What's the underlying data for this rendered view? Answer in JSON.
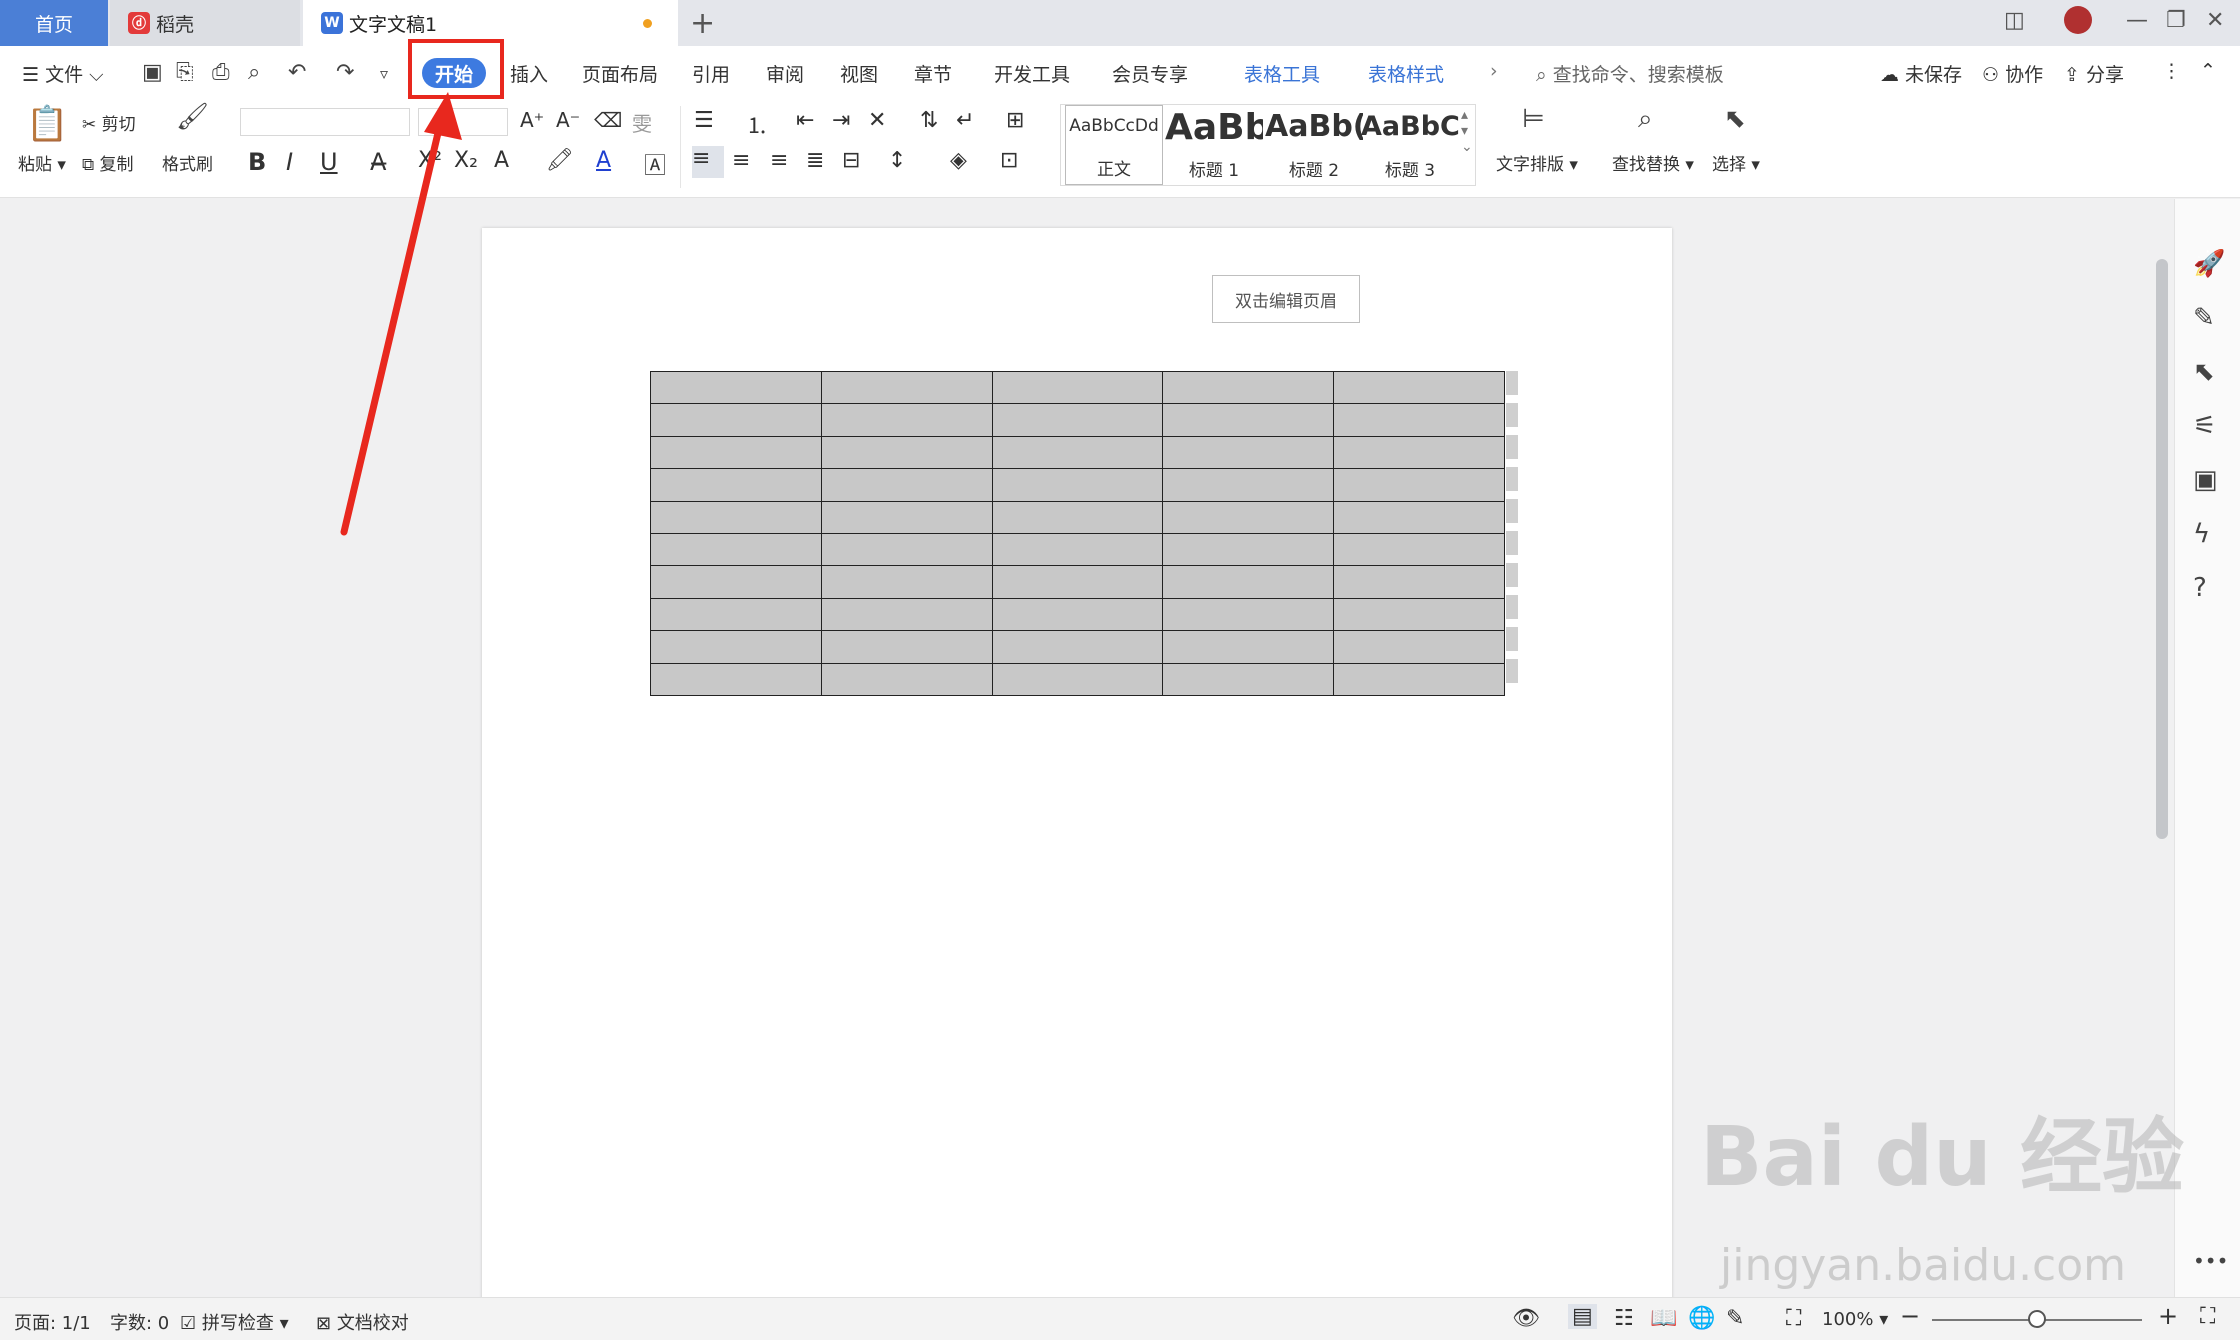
{
  "tabs": {
    "home": "首页",
    "daoke": "稻壳",
    "doc": "文字文稿1"
  },
  "menu": {
    "file": "文件",
    "start": "开始",
    "insert": "插入",
    "layout": "页面布局",
    "reference": "引用",
    "review": "审阅",
    "view": "视图",
    "chapter": "章节",
    "devtools": "开发工具",
    "member": "会员专享",
    "table_tools": "表格工具",
    "table_style": "表格样式",
    "search_placeholder": "查找命令、搜索模板",
    "unsaved": "未保存",
    "collab": "协作",
    "share": "分享"
  },
  "toolbar": {
    "paste": "粘贴",
    "cut": "剪切",
    "copy": "复制",
    "format_painter": "格式刷",
    "text_layout": "文字排版",
    "find_replace": "查找替换",
    "select": "选择",
    "styles": [
      {
        "sample": "AaBbCcDd",
        "label": "正文"
      },
      {
        "sample": "AaBb",
        "label": "标题 1"
      },
      {
        "sample": "AaBb(",
        "label": "标题 2"
      },
      {
        "sample": "AaBbC",
        "label": "标题 3"
      }
    ]
  },
  "document": {
    "header_hint": "双击编辑页眉",
    "table_rows": 10,
    "table_cols": 5
  },
  "status": {
    "page": "页面: 1/1",
    "words": "字数: 0",
    "spellcheck": "拼写检查",
    "proofread": "文档校对",
    "zoom": "100%"
  },
  "watermark": {
    "brand": "Bai du 经验",
    "url": "jingyan.baidu.com"
  },
  "colors": {
    "accent": "#3d7ae0",
    "annotation": "#e8281e"
  }
}
